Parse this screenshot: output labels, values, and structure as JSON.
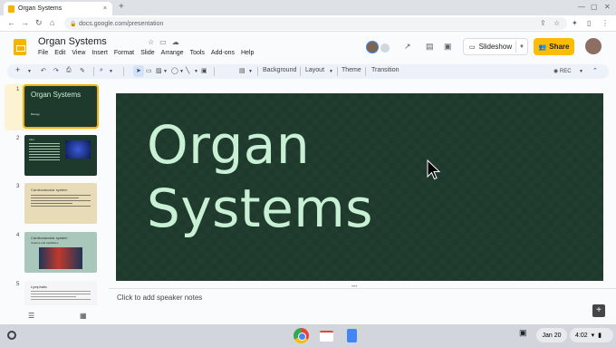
{
  "browser": {
    "tab_title": "Organ Systems",
    "tab_close": "×",
    "new_tab": "+",
    "url": "docs.google.com/presentation",
    "nav_back": "←",
    "nav_forward": "→",
    "nav_reload": "↻",
    "nav_home": "⌂"
  },
  "app": {
    "title": "Organ Systems",
    "menus": [
      "File",
      "Edit",
      "View",
      "Insert",
      "Format",
      "Slide",
      "Arrange",
      "Tools",
      "Add-ons",
      "Help"
    ],
    "slideshow_label": "Slideshow",
    "share_label": "Share"
  },
  "toolbar": {
    "background_label": "Background",
    "layout_label": "Layout",
    "theme_label": "Theme",
    "transition_label": "Transition",
    "rec_label": "REC"
  },
  "filmstrip": {
    "slides": [
      {
        "num": "1",
        "title": "Organ Systems",
        "subtitle": "Biology"
      },
      {
        "num": "2",
        "title": "Intro"
      },
      {
        "num": "3",
        "title": "Cardiovascular system"
      },
      {
        "num": "4",
        "title": "Cardiovascular system",
        "subtitle": "Arteries and capillaries"
      },
      {
        "num": "5",
        "title": "Lymphatic"
      }
    ]
  },
  "slide": {
    "title_line1": "Organ",
    "title_line2": "Systems",
    "bg_color": "#1e3a2c",
    "text_color": "#c8f0d4"
  },
  "notes": {
    "placeholder": "Click to add speaker notes"
  },
  "shelf": {
    "date": "Jan 20",
    "time": "4:02"
  }
}
